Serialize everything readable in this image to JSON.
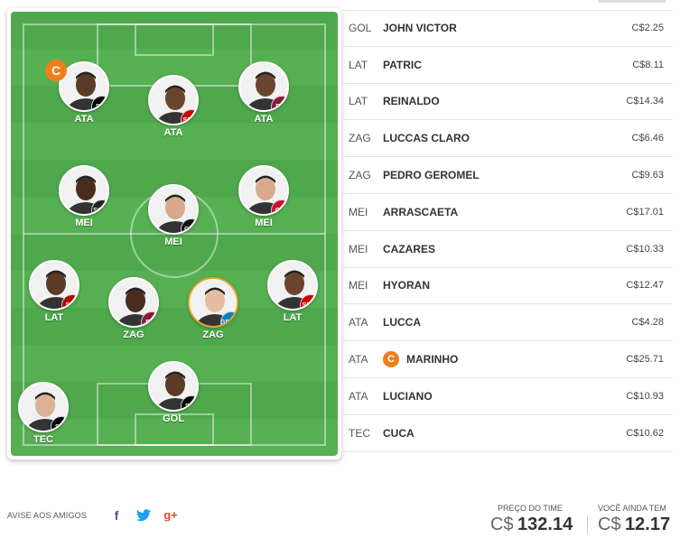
{
  "lineup": [
    {
      "pos": "ATA",
      "club": "SFC",
      "club_color": "#000000",
      "captain": true,
      "skin": "#5b3a26"
    },
    {
      "pos": "ATA",
      "club": "SPFC",
      "club_color": "#d00000",
      "captain": false,
      "skin": "#6b4430"
    },
    {
      "pos": "ATA",
      "club": "FFC",
      "club_color": "#8a1b36",
      "captain": false,
      "skin": "#6b4430"
    },
    {
      "pos": "MEI",
      "club": "SCCP",
      "club_color": "#222222",
      "captain": false,
      "skin": "#4a2c1c"
    },
    {
      "pos": "MEI",
      "club": "CAM",
      "club_color": "#111111",
      "captain": false,
      "skin": "#d7a98a"
    },
    {
      "pos": "MEI",
      "club": "CRF",
      "club_color": "#c8102e",
      "captain": false,
      "skin": "#d9a98c"
    },
    {
      "pos": "LAT",
      "club": "SCR",
      "club_color": "#b30000",
      "captain": false,
      "skin": "#5e3b27"
    },
    {
      "pos": "ZAG",
      "club": "FFC",
      "club_color": "#8a1b36",
      "captain": false,
      "skin": "#4a2c1c"
    },
    {
      "pos": "ZAG",
      "club": "GFBPA",
      "club_color": "#0d80bf",
      "captain": false,
      "skin": "#e4bca0"
    },
    {
      "pos": "LAT",
      "club": "SPFC",
      "club_color": "#d00000",
      "captain": false,
      "skin": "#6b4430"
    },
    {
      "pos": "GOL",
      "club": "SFC",
      "club_color": "#000000",
      "captain": false,
      "skin": "#5e3b27"
    },
    {
      "pos": "TEC",
      "club": "SFC",
      "club_color": "#000000",
      "captain": false,
      "skin": "#dcb196"
    }
  ],
  "captain_mark": "C",
  "players": [
    {
      "pos": "GOL",
      "name": "JOHN VICTOR",
      "price": "C$2.25",
      "captain": false
    },
    {
      "pos": "LAT",
      "name": "PATRIC",
      "price": "C$8.11",
      "captain": false
    },
    {
      "pos": "LAT",
      "name": "REINALDO",
      "price": "C$14.34",
      "captain": false
    },
    {
      "pos": "ZAG",
      "name": "LUCCAS CLARO",
      "price": "C$6.46",
      "captain": false
    },
    {
      "pos": "ZAG",
      "name": "PEDRO GEROMEL",
      "price": "C$9.63",
      "captain": false
    },
    {
      "pos": "MEI",
      "name": "ARRASCAETA",
      "price": "C$17.01",
      "captain": false
    },
    {
      "pos": "MEI",
      "name": "CAZARES",
      "price": "C$10.33",
      "captain": false
    },
    {
      "pos": "MEI",
      "name": "HYORAN",
      "price": "C$12.47",
      "captain": false
    },
    {
      "pos": "ATA",
      "name": "LUCCA",
      "price": "C$4.28",
      "captain": false
    },
    {
      "pos": "ATA",
      "name": "MARINHO",
      "price": "C$25.71",
      "captain": true
    },
    {
      "pos": "ATA",
      "name": "LUCIANO",
      "price": "C$10.93",
      "captain": false
    },
    {
      "pos": "TEC",
      "name": "CUCA",
      "price": "C$10.62",
      "captain": false
    }
  ],
  "footer": {
    "share_label": "AVISE AOS AMIGOS",
    "facebook_icon": "f",
    "twitter_icon": "🐦",
    "googleplus_icon": "g+",
    "team_price_label": "PREÇO DO TIME",
    "team_price_currency": "C$",
    "team_price_value": "132.14",
    "remaining_label": "VOCÊ AINDA TEM",
    "remaining_currency": "C$",
    "remaining_value": "12.17"
  },
  "colors": {
    "field_green": "#4fa84c",
    "captain_orange": "#f07e1b",
    "gold_border": "#e2a52a"
  }
}
